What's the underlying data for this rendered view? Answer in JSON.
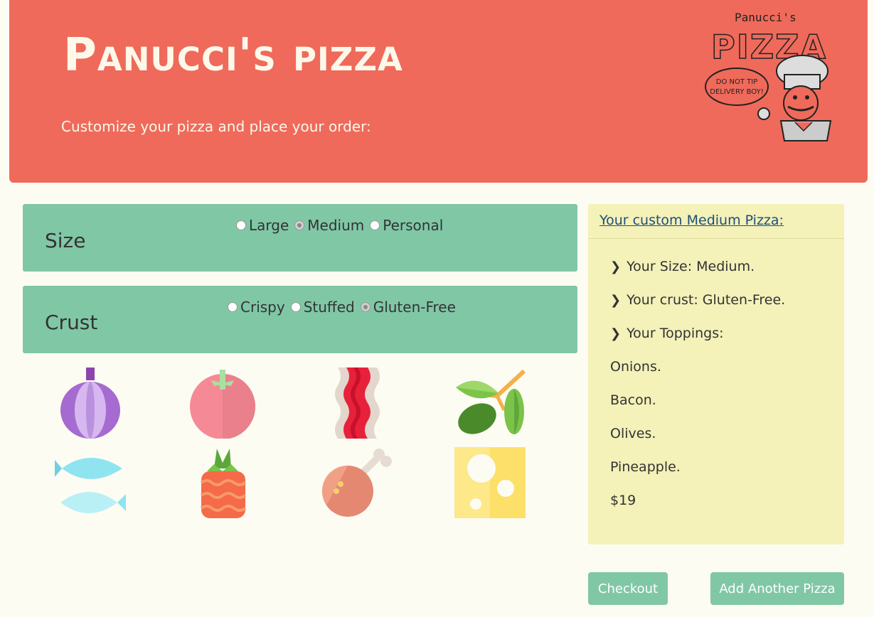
{
  "header": {
    "title": "Panucci's pizza",
    "subtitle": "Customize your pizza and place your order:",
    "logo": {
      "brand_small": "Panucci's",
      "brand_big": "PIZZA",
      "speech": "DO NOT TIP DELIVERY BOY!"
    }
  },
  "size": {
    "label": "Size",
    "options": [
      {
        "label": "Large",
        "checked": false
      },
      {
        "label": "Medium",
        "checked": true
      },
      {
        "label": "Personal",
        "checked": false
      }
    ]
  },
  "crust": {
    "label": "Crust",
    "options": [
      {
        "label": "Crispy",
        "checked": false
      },
      {
        "label": "Stuffed",
        "checked": false
      },
      {
        "label": "Gluten-Free",
        "checked": true
      }
    ]
  },
  "toppings": [
    {
      "icon": "onion-icon"
    },
    {
      "icon": "tomato-icon"
    },
    {
      "icon": "bacon-icon"
    },
    {
      "icon": "olives-icon"
    },
    {
      "icon": "fish-icon"
    },
    {
      "icon": "pineapple-icon"
    },
    {
      "icon": "chicken-leg-icon"
    },
    {
      "icon": "cheese-icon"
    }
  ],
  "summary": {
    "heading": "Your custom Medium Pizza:",
    "size_line": "Your Size: Medium.",
    "crust_line": "Your crust: Gluten-Free.",
    "toppings_label": "Your Toppings:",
    "toppings": [
      "Onions.",
      "Bacon.",
      "Olives.",
      "Pineapple."
    ],
    "price": "$19"
  },
  "buttons": {
    "checkout": "Checkout",
    "add_another": "Add Another Pizza"
  },
  "colors": {
    "header_bg": "#ef6a5b",
    "panel_bg": "#80c7a6",
    "summary_bg": "#f4f1b9",
    "page_bg": "#fdfcf3"
  }
}
